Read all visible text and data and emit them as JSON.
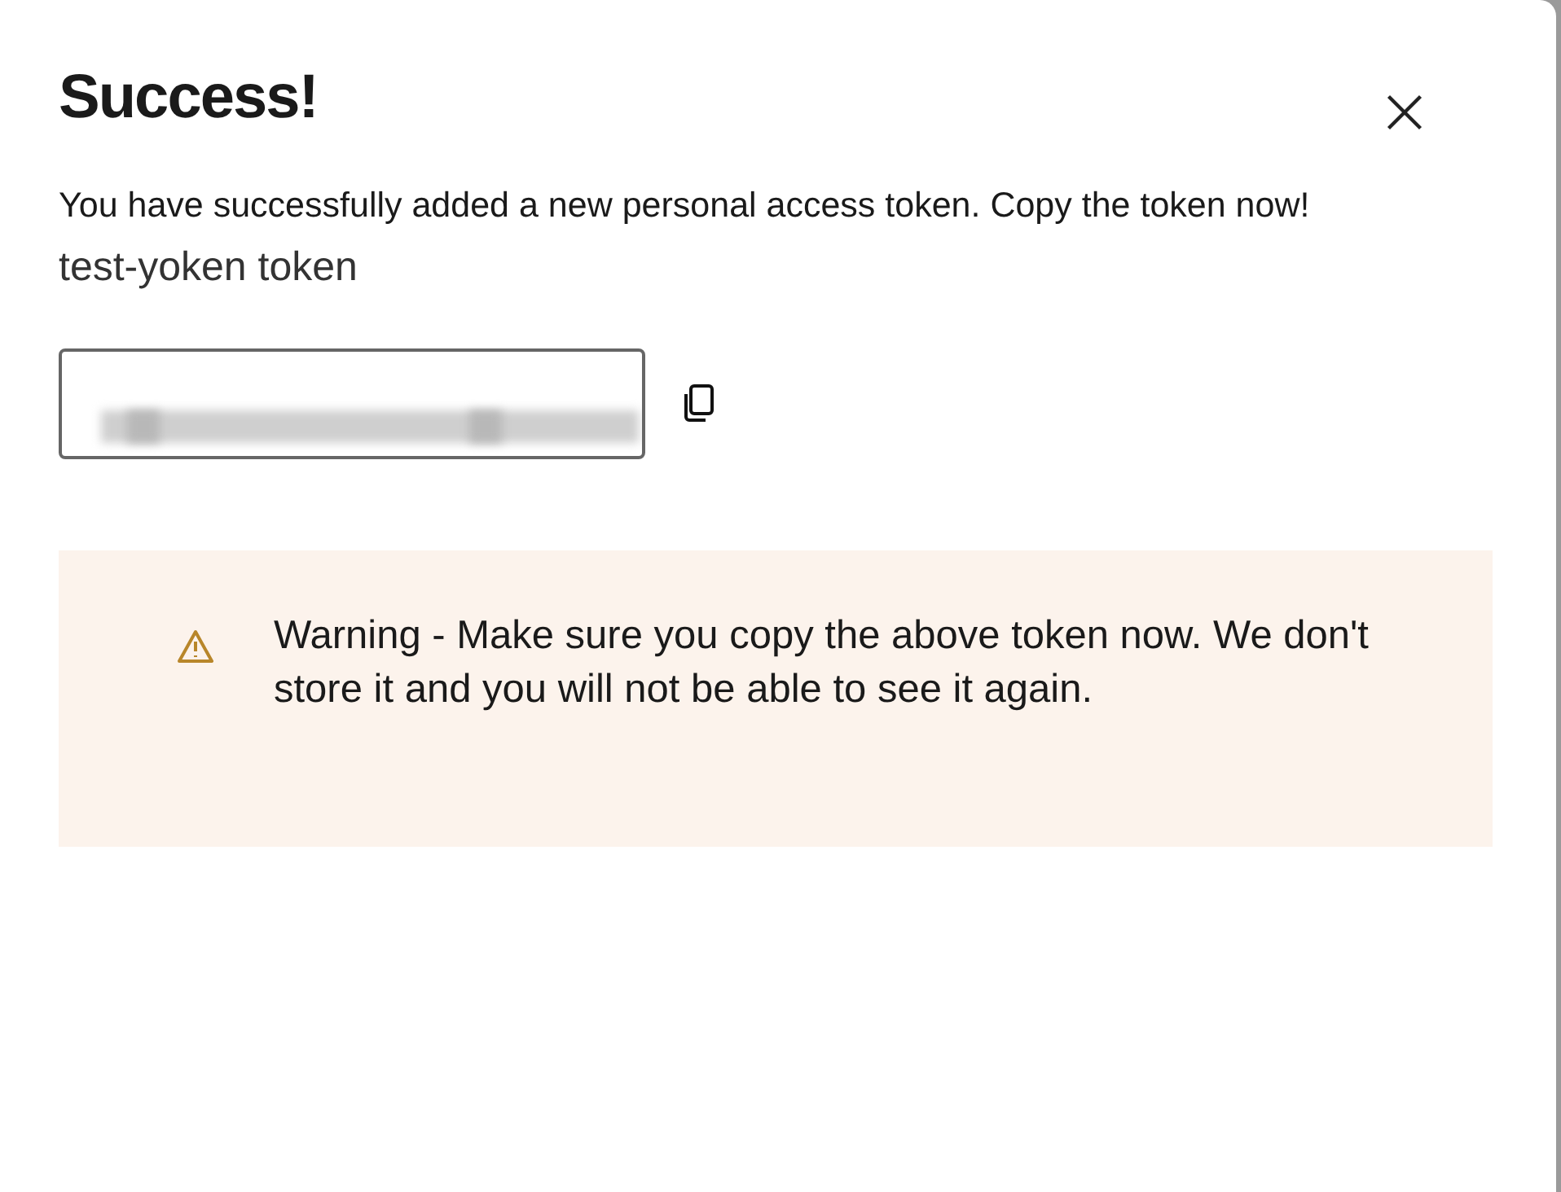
{
  "dialog": {
    "title": "Success!",
    "message": "You have successfully added a new personal access token. Copy the token now!",
    "token_name": "test-yoken token",
    "warning": "Warning - Make sure you copy the above token now. We don't store it and you will not be able to see it again."
  }
}
